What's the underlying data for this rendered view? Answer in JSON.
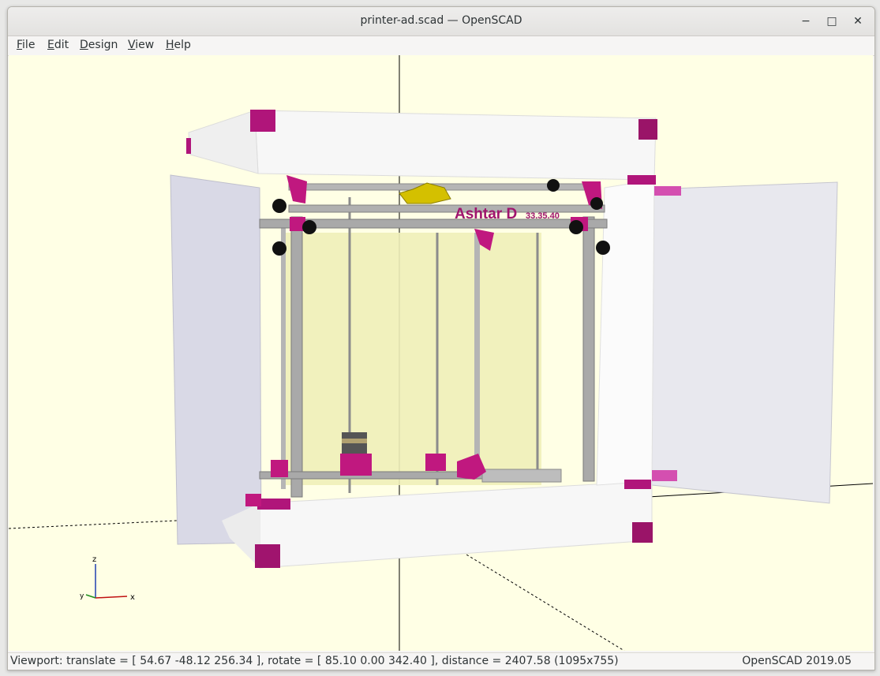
{
  "window": {
    "title": "printer-ad.scad — OpenSCAD",
    "minimize_glyph": "−",
    "maximize_glyph": "□",
    "close_glyph": "✕"
  },
  "menu": [
    {
      "label": "File",
      "accel": "F",
      "rest": "ile"
    },
    {
      "label": "Edit",
      "accel": "E",
      "rest": "dit"
    },
    {
      "label": "Design",
      "accel": "D",
      "rest": "esign"
    },
    {
      "label": "View",
      "accel": "V",
      "rest": "iew"
    },
    {
      "label": "Help",
      "accel": "H",
      "rest": "elp"
    }
  ],
  "viewport": {
    "background_color": "#ffffe5",
    "model_label": "Ashtar D",
    "model_sublabel": "33.35.40",
    "axes": {
      "x": "x",
      "y": "y",
      "z": "z"
    }
  },
  "status": {
    "viewport_info": "Viewport: translate = [ 54.67 -48.12 256.34 ], rotate = [ 85.10 0.00 342.40 ], distance = 2407.58 (1095x755)",
    "version": "OpenSCAD 2019.05"
  },
  "colors": {
    "accent_magenta": "#c0187f",
    "frame_gray": "#a9a9a9",
    "panel_white": "#f7f7f7"
  }
}
